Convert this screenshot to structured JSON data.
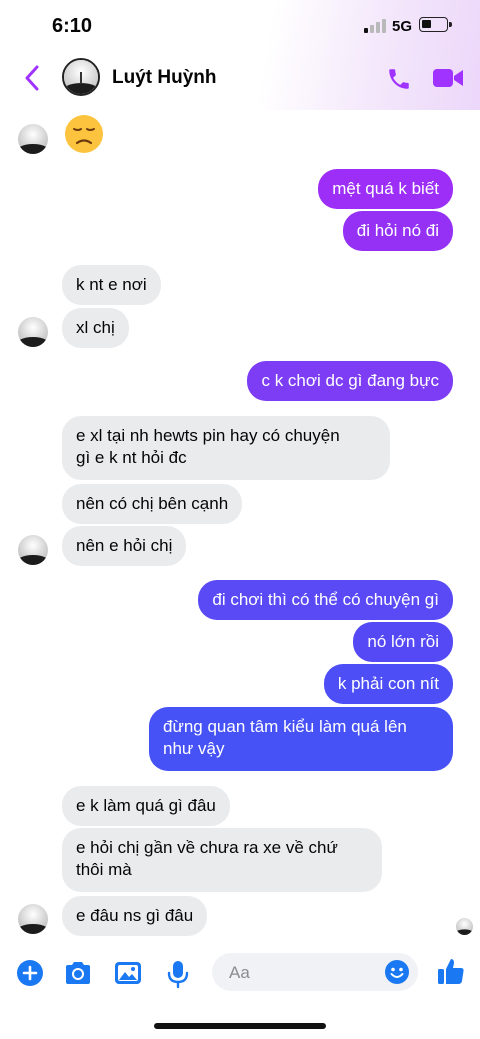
{
  "status_bar": {
    "time": "6:10",
    "network": "5G"
  },
  "header": {
    "contact_name": "Luýt Huỳnh"
  },
  "colors": {
    "accent": "#a033ff",
    "outgoing_top": "#9c2ef7",
    "outgoing_bottom": "#3d52f5",
    "incoming": "#eaebed"
  },
  "messages": [
    {
      "side": "in",
      "text": "k nt e nơi"
    },
    {
      "side": "in",
      "text": "xl chị"
    },
    {
      "side": "out",
      "text": "mệt quá k biết"
    },
    {
      "side": "out",
      "text": "đi hỏi nó đi"
    },
    {
      "side": "out",
      "text": "c k chơi dc gì đang bực"
    },
    {
      "side": "in",
      "text": "e xl tại nh hewts pin hay có chuyện"
    },
    {
      "side": "in",
      "text": "gì e k nt hỏi đc"
    },
    {
      "side": "in",
      "text": "nên có chị bên cạnh"
    },
    {
      "side": "in",
      "text": "nên e hỏi chị"
    },
    {
      "side": "out",
      "text": "đi chơi thì có thể có chuyện gì"
    },
    {
      "side": "out",
      "text": "nó lớn rồi"
    },
    {
      "side": "out",
      "text": "k phải con nít"
    },
    {
      "side": "out",
      "text": "đừng quan tâm kiểu làm quá lên"
    },
    {
      "side": "out",
      "text": "như vậy"
    },
    {
      "side": "in",
      "text": "e k làm quá gì đâu"
    },
    {
      "side": "in",
      "text": "e hỏi chị gần về chưa ra xe về chứ"
    },
    {
      "side": "in",
      "text": "thôi mà"
    },
    {
      "side": "in",
      "text": "e đâu ns gì đâu"
    }
  ],
  "composer": {
    "placeholder": "Aa"
  },
  "icons": [
    "back-chevron-icon",
    "phone-icon",
    "video-icon",
    "plus-icon",
    "camera-icon",
    "image-icon",
    "microphone-icon",
    "emoji-icon",
    "thumbs-up-icon",
    "sad-emoji-icon"
  ]
}
